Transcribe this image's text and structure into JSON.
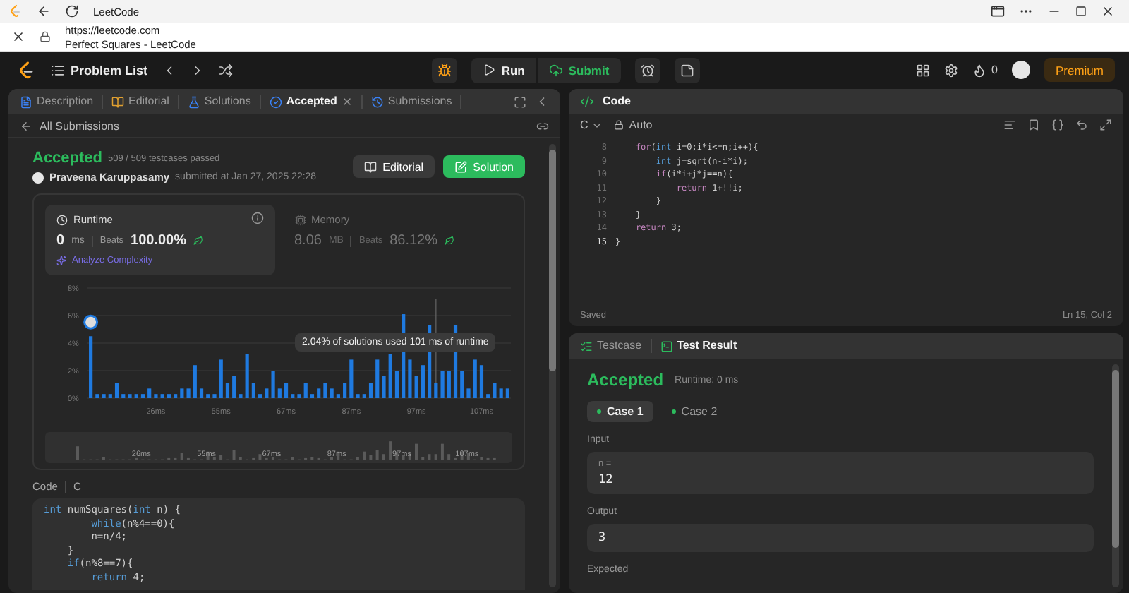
{
  "browser": {
    "tab_title": "LeetCode",
    "url": "https://leetcode.com",
    "page_title": "Perfect Squares - LeetCode"
  },
  "nav": {
    "problem_list": "Problem List",
    "run": "Run",
    "submit": "Submit",
    "streak": "0",
    "premium": "Premium"
  },
  "left_tabs": [
    {
      "label": "Description",
      "kind": "description",
      "selected": false,
      "closable": false
    },
    {
      "label": "Editorial",
      "kind": "editorial",
      "selected": false,
      "closable": false
    },
    {
      "label": "Solutions",
      "kind": "solutions",
      "selected": false,
      "closable": false
    },
    {
      "label": "Accepted",
      "kind": "accepted",
      "selected": true,
      "closable": true
    },
    {
      "label": "Submissions",
      "kind": "submissions",
      "selected": false,
      "closable": false
    }
  ],
  "back_link": "All Submissions",
  "result": {
    "status": "Accepted",
    "passed": "509 / 509 testcases passed",
    "author": "Praveena Karuppasamy",
    "submitted": "submitted at Jan 27, 2025 22:28",
    "buttons": [
      {
        "label": "Editorial",
        "kind": "secondary"
      },
      {
        "label": "Solution",
        "kind": "primary"
      }
    ]
  },
  "stats": [
    {
      "title": "Runtime",
      "kind": "time",
      "selected": true,
      "value": "0",
      "unit": "ms",
      "beats_label": "Beats",
      "beats": "100.00%",
      "link": "Analyze Complexity"
    },
    {
      "title": "Memory",
      "kind": "memory",
      "selected": false,
      "value": "8.06",
      "unit": "MB",
      "beats_label": "Beats",
      "beats": "86.12%"
    }
  ],
  "chart_data": {
    "type": "bar",
    "categories": [
      null,
      null,
      null,
      null,
      null,
      null,
      null,
      null,
      null,
      null,
      "26ms",
      null,
      null,
      null,
      null,
      null,
      null,
      null,
      null,
      null,
      "55ms",
      null,
      null,
      null,
      null,
      null,
      null,
      null,
      null,
      null,
      "67ms",
      null,
      null,
      null,
      null,
      null,
      null,
      null,
      null,
      null,
      "87ms",
      null,
      null,
      null,
      null,
      null,
      null,
      null,
      null,
      null,
      "97ms",
      null,
      null,
      null,
      null,
      null,
      null,
      null,
      null,
      null,
      "107ms",
      null,
      null,
      null,
      null
    ],
    "series": [
      {
        "color": "#1f7ae0",
        "values": [
          4.5,
          0.3,
          0.3,
          0.3,
          1.1,
          0.3,
          0.3,
          0.3,
          0.3,
          0.7,
          0.3,
          0.3,
          0.3,
          0.3,
          0.7,
          0.7,
          2.4,
          0.7,
          0.3,
          0.3,
          2.8,
          1.1,
          1.6,
          0.3,
          3.2,
          1.1,
          0.3,
          0.7,
          2.0,
          0.7,
          1.1,
          0.3,
          0.3,
          1.1,
          0.3,
          0.7,
          1.1,
          0.7,
          0.3,
          1.1,
          2.8,
          0.3,
          0.3,
          1.1,
          2.8,
          1.6,
          3.2,
          2.0,
          6.1,
          2.8,
          1.6,
          2.4,
          5.3,
          1.1,
          2.0,
          2.0,
          5.3,
          2.0,
          0.7,
          2.8,
          2.4,
          0.3,
          1.1,
          0.7,
          0.7
        ]
      }
    ],
    "ylim": [
      0,
      8
    ],
    "grid": true,
    "yticks": [
      {
        "value": 0,
        "label": "0%"
      },
      {
        "value": 2,
        "label": "2%"
      },
      {
        "value": 4,
        "label": "4%"
      },
      {
        "value": 6,
        "label": "6%"
      },
      {
        "value": 8,
        "label": "8%"
      }
    ],
    "annotations": [
      {
        "text": "2.04% of solutions used 101 ms of runtime"
      }
    ]
  },
  "minimap": {
    "labels": [
      "26ms",
      "55ms",
      "67ms",
      "87ms",
      "97ms",
      "107ms"
    ]
  },
  "code_section": {
    "label": "Code",
    "language": "C",
    "lines": [
      [
        {
          "text": "int",
          "kind": "keyword"
        },
        {
          "text": " numSquares(",
          "kind": "plain"
        },
        {
          "text": "int",
          "kind": "keyword"
        },
        {
          "text": " n) {",
          "kind": "plain"
        }
      ],
      [
        {
          "text": "        while",
          "kind": "keyword"
        },
        {
          "text": "(n%4==0){",
          "kind": "plain"
        }
      ],
      [
        {
          "text": "        n=n/4;",
          "kind": "plain"
        }
      ],
      [
        {
          "text": "    }",
          "kind": "plain"
        }
      ],
      [
        {
          "text": "    if",
          "kind": "keyword"
        },
        {
          "text": "(n%8==7){",
          "kind": "plain"
        }
      ],
      [
        {
          "text": "        return",
          "kind": "keyword"
        },
        {
          "text": " 4;",
          "kind": "plain"
        }
      ]
    ]
  },
  "editor": {
    "title": "Code",
    "language": "C",
    "mode": "Auto",
    "status": "Saved",
    "position": "Ln 15, Col 2",
    "lines": [
      {
        "number": "8",
        "current": false,
        "tokens": [
          {
            "text": "    for",
            "kind": "keyword"
          },
          {
            "text": "(",
            "kind": "plain"
          },
          {
            "text": "int",
            "kind": "type"
          },
          {
            "text": " i=0;i*i<=n;i++){",
            "kind": "plain"
          }
        ]
      },
      {
        "number": "9",
        "current": false,
        "tokens": [
          {
            "text": "        int",
            "kind": "type"
          },
          {
            "text": " j=sqrt(n-i*i);",
            "kind": "plain"
          }
        ]
      },
      {
        "number": "10",
        "current": false,
        "tokens": [
          {
            "text": "        if",
            "kind": "keyword"
          },
          {
            "text": "(i*i+j*j==n){",
            "kind": "plain"
          }
        ]
      },
      {
        "number": "11",
        "current": false,
        "tokens": [
          {
            "text": "            return",
            "kind": "keyword"
          },
          {
            "text": " 1+!!i;",
            "kind": "plain"
          }
        ]
      },
      {
        "number": "12",
        "current": false,
        "tokens": [
          {
            "text": "        }",
            "kind": "plain"
          }
        ]
      },
      {
        "number": "13",
        "current": false,
        "tokens": [
          {
            "text": "    }",
            "kind": "plain"
          }
        ]
      },
      {
        "number": "14",
        "current": false,
        "tokens": [
          {
            "text": "    return",
            "kind": "keyword"
          },
          {
            "text": " 3;",
            "kind": "plain"
          }
        ]
      },
      {
        "number": "15",
        "current": true,
        "tokens": [
          {
            "text": "}",
            "kind": "plain"
          }
        ]
      }
    ]
  },
  "console": {
    "tabs": [
      {
        "label": "Testcase",
        "kind": "testcase",
        "selected": false
      },
      {
        "label": "Test Result",
        "kind": "result",
        "selected": true
      }
    ],
    "status": "Accepted",
    "runtime": "Runtime: 0 ms",
    "cases": [
      {
        "label": "Case 1",
        "selected": true,
        "passed": true
      },
      {
        "label": "Case 2",
        "selected": false,
        "passed": true
      }
    ],
    "input_label": "Input",
    "inputs": [
      {
        "name": "n =",
        "value": "12"
      }
    ],
    "output_label": "Output",
    "output": "3",
    "expected_label": "Expected"
  }
}
